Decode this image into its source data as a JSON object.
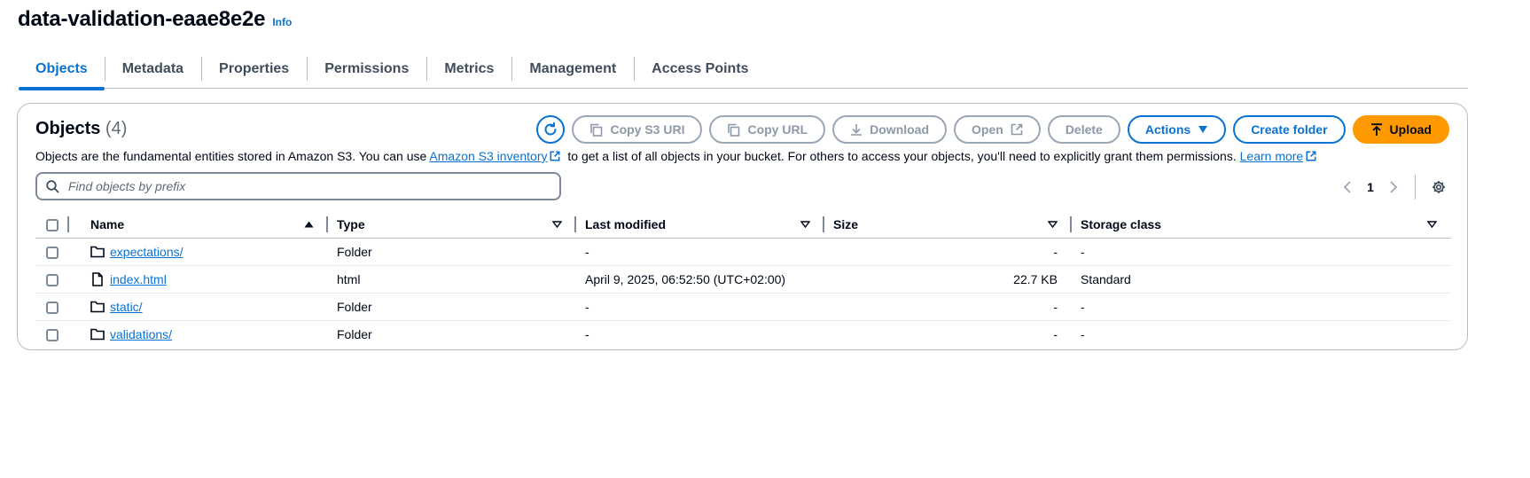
{
  "header": {
    "title": "data-validation-eaae8e2e",
    "info_label": "Info"
  },
  "tabs": [
    {
      "label": "Objects",
      "active": true
    },
    {
      "label": "Metadata"
    },
    {
      "label": "Properties"
    },
    {
      "label": "Permissions"
    },
    {
      "label": "Metrics"
    },
    {
      "label": "Management"
    },
    {
      "label": "Access Points"
    }
  ],
  "objects_panel": {
    "heading": "Objects",
    "count": "(4)",
    "description": {
      "part1": "Objects are the fundamental entities stored in Amazon S3. You can use ",
      "link1": "Amazon S3 inventory",
      "part2": " to get a list of all objects in your bucket. For others to access your objects, you'll need to explicitly grant them permissions. ",
      "link2": "Learn more"
    },
    "toolbar": {
      "copy_s3_uri": "Copy S3 URI",
      "copy_url": "Copy URL",
      "download": "Download",
      "open": "Open",
      "delete": "Delete",
      "actions": "Actions",
      "create_folder": "Create folder",
      "upload": "Upload"
    },
    "search": {
      "placeholder": "Find objects by prefix",
      "value": ""
    },
    "pagination": {
      "current_page": "1"
    },
    "columns": {
      "name": "Name",
      "type": "Type",
      "last_modified": "Last modified",
      "size": "Size",
      "storage_class": "Storage class"
    },
    "rows": [
      {
        "icon": "folder-icon",
        "name": "expectations/",
        "type": "Folder",
        "last_modified": "-",
        "size": "-",
        "storage_class": "-"
      },
      {
        "icon": "file-icon",
        "name": "index.html",
        "type": "html",
        "last_modified": "April 9, 2025, 06:52:50 (UTC+02:00)",
        "size": "22.7 KB",
        "storage_class": "Standard"
      },
      {
        "icon": "folder-icon",
        "name": "static/",
        "type": "Folder",
        "last_modified": "-",
        "size": "-",
        "storage_class": "-"
      },
      {
        "icon": "folder-icon",
        "name": "validations/",
        "type": "Folder",
        "last_modified": "-",
        "size": "-",
        "storage_class": "-"
      }
    ]
  },
  "colors": {
    "link": "#0972d3",
    "primary_button": "#ff9900",
    "disabled": "#9ba7b6",
    "border": "#b6bec9"
  }
}
